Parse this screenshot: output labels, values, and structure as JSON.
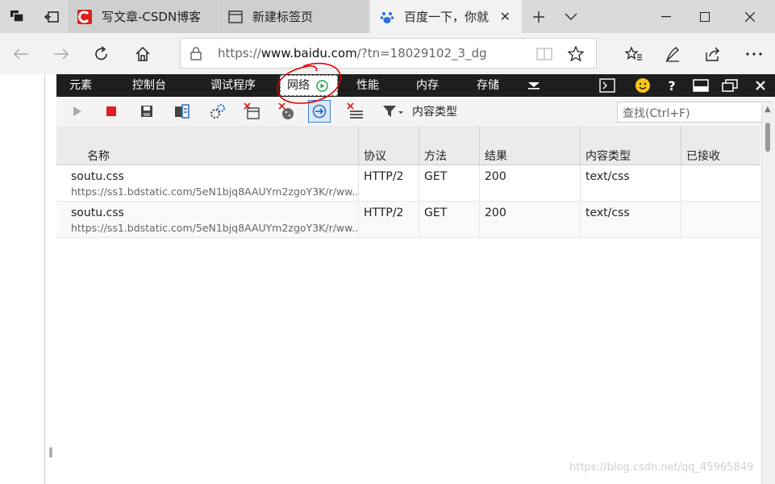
{
  "tabs": [
    {
      "label": "写文章-CSDN博客",
      "icon": "csdn-logo-icon"
    },
    {
      "label": "新建标签页",
      "icon": "page-icon"
    },
    {
      "label": "百度一下，你就",
      "icon": "baidu-paw-icon"
    }
  ],
  "addressbar": {
    "url_prefix": "https://",
    "url_host": "www.baidu.com",
    "url_path": "/?tn=18029102_3_dg"
  },
  "devtools": {
    "tabs": [
      "元素",
      "控制台",
      "调试程序",
      "网络",
      "性能",
      "内存",
      "存储"
    ],
    "selected_tab": "网络",
    "content_type_label": "内容类型",
    "find_placeholder": "查找(Ctrl+F)"
  },
  "table": {
    "columns": [
      "名称",
      "协议",
      "方法",
      "结果",
      "内容类型",
      "已接收"
    ],
    "rows": [
      {
        "name": "soutu.css",
        "url": "https://ss1.bdstatic.com/5eN1bjq8AAUYm2zgoY3K/r/ww...",
        "protocol": "HTTP/2",
        "method": "GET",
        "result": "200",
        "content_type": "text/css",
        "received": ""
      },
      {
        "name": "soutu.css",
        "url": "https://ss1.bdstatic.com/5eN1bjq8AAUYm2zgoY3K/r/ww...",
        "protocol": "HTTP/2",
        "method": "GET",
        "result": "200",
        "content_type": "text/css",
        "received": ""
      }
    ]
  },
  "watermark": "https://blog.csdn.net/qq_45965849",
  "colors": {
    "accent": "#3b7dd8",
    "record_stop": "#e02020",
    "devtools_bar": "#1e1e1e",
    "annotation": "#e00000"
  }
}
